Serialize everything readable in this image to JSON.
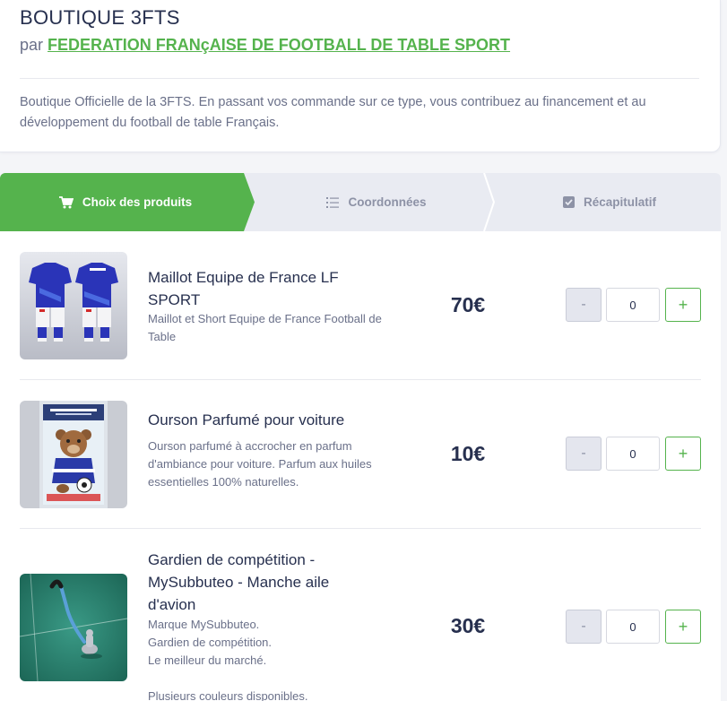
{
  "shop": {
    "title": "BOUTIQUE 3FTS",
    "by_prefix": "par",
    "organization": "FEDERATION FRANçAISE DE FOOTBALL DE TABLE SPORT",
    "description": "Boutique Officielle de la 3FTS. En passant vos commande sur ce type, vous contribuez au financement et au développement du football de table Français."
  },
  "steps": [
    {
      "label": "Choix des produits",
      "icon": "cart-icon",
      "active": true
    },
    {
      "label": "Coordonnées",
      "icon": "list-icon",
      "active": false
    },
    {
      "label": "Récapitulatif",
      "icon": "checkbox-icon",
      "active": false
    }
  ],
  "products": [
    {
      "name": "Maillot Equipe de France LF SPORT",
      "description": "Maillot et Short Equipe de France Football de Table",
      "price": "70€",
      "quantity": "0",
      "minus_label": "-",
      "plus_label": "+"
    },
    {
      "name": "Ourson Parfumé pour voiture",
      "description": "Ourson parfumé à accrocher en parfum d'ambiance pour voiture. Parfum aux huiles essentielles 100% naturelles.",
      "price": "10€",
      "quantity": "0",
      "minus_label": "-",
      "plus_label": "+"
    },
    {
      "name": "Gardien de compétition - MySubbuteo - Manche aile d'avion",
      "description": "Marque MySubbuteo.\nGardien de compétition.\nLe meilleur du marché.\n\nPlusieurs couleurs disponibles.",
      "price": "30€",
      "quantity": "0",
      "minus_label": "-",
      "plus_label": "+"
    }
  ],
  "colors": {
    "accent": "#55b34d",
    "text": "#27304f",
    "muted": "#6a7089"
  }
}
